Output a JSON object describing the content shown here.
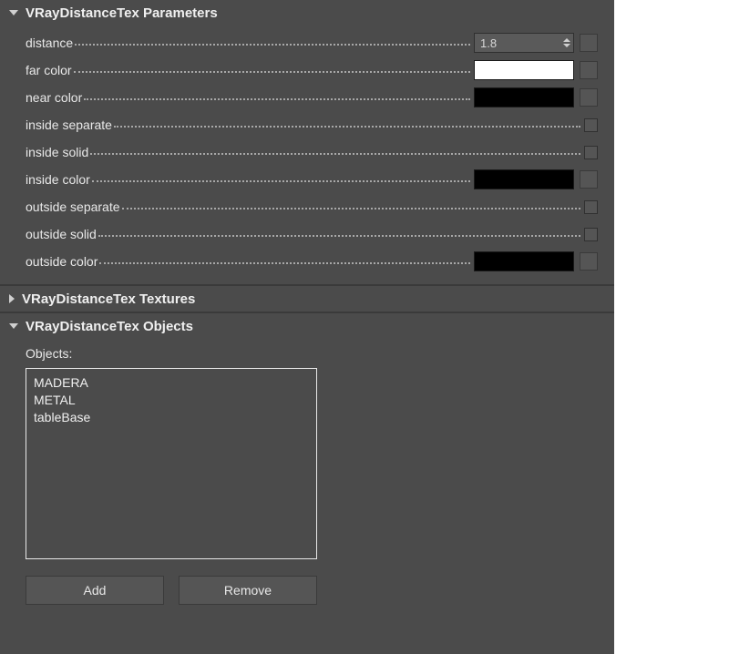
{
  "panels": {
    "params": {
      "title": "VRayDistanceTex Parameters",
      "rows": {
        "distance": {
          "label": "distance",
          "value": "1.8"
        },
        "far_color": {
          "label": "far color",
          "swatch": "#ffffff"
        },
        "near_color": {
          "label": "near color",
          "swatch": "#000000"
        },
        "inside_separate": {
          "label": "inside separate"
        },
        "inside_solid": {
          "label": "inside solid"
        },
        "inside_color": {
          "label": "inside color",
          "swatch": "#000000"
        },
        "outside_separate": {
          "label": "outside separate"
        },
        "outside_solid": {
          "label": "outside solid"
        },
        "outside_color": {
          "label": "outside color",
          "swatch": "#000000"
        }
      }
    },
    "textures": {
      "title": "VRayDistanceTex Textures"
    },
    "objects": {
      "title": "VRayDistanceTex Objects",
      "list_label": "Objects:",
      "items": [
        "MADERA",
        "METAL",
        "tableBase"
      ],
      "add_label": "Add",
      "remove_label": "Remove"
    }
  }
}
